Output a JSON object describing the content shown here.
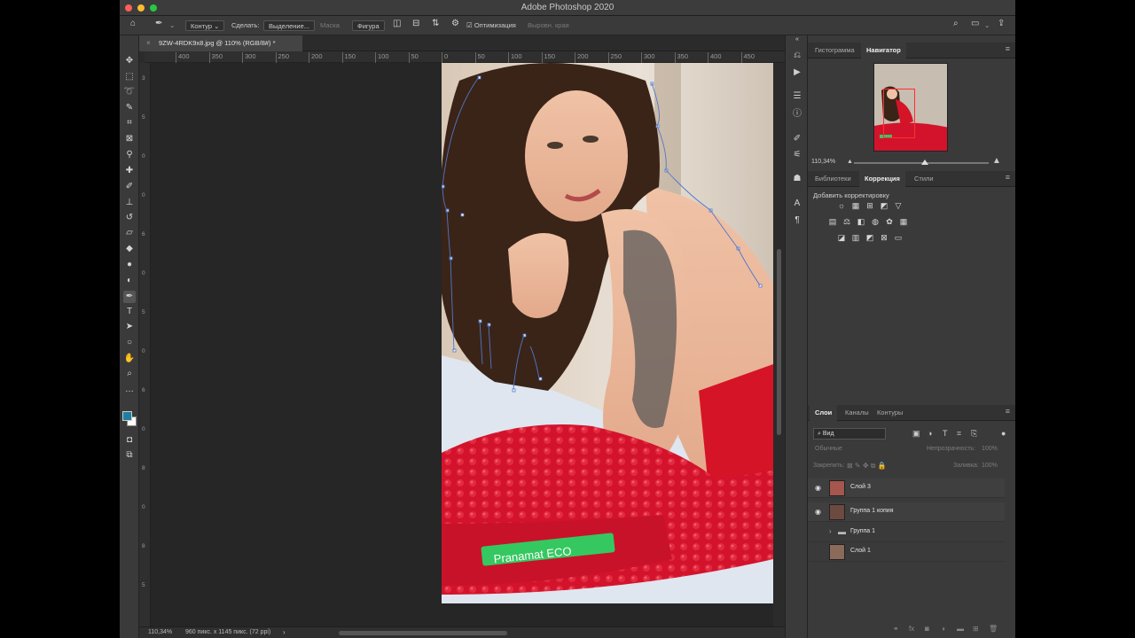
{
  "window": {
    "title": "Adobe Photoshop 2020",
    "colors": {
      "close": "#fe5f57",
      "minimize": "#febc2e",
      "zoom": "#28c840"
    }
  },
  "options_bar": {
    "mode": "Контур",
    "make_label": "Сделать:",
    "selection_button": "Выделение...",
    "mask_button": "Маска",
    "shape_button": "Фигура",
    "optimize_label": "Оптимизация",
    "align_edges": "Выровн. края"
  },
  "document": {
    "tab_title": "9ZW-4RDK9x8.jpg @ 110% (RGB/8#) *"
  },
  "ruler": {
    "h_ticks": [
      "400",
      "350",
      "300",
      "250",
      "200",
      "150",
      "100",
      "50",
      "0",
      "50",
      "100",
      "150",
      "200",
      "250",
      "300",
      "350",
      "400",
      "450"
    ],
    "v_ticks": [
      "3",
      "5",
      "0",
      "0",
      "6",
      "0",
      "5",
      "0",
      "6",
      "0",
      "8",
      "0",
      "8",
      "5"
    ]
  },
  "status": {
    "zoom": "110,34%",
    "doc_info": "960 пикс. x 1145 пикс. (72 ppi)",
    "arrow": "›"
  },
  "navigator": {
    "tabs": [
      "Гистограмма",
      "Навигатор"
    ],
    "active_tab": "Навигатор",
    "zoom": "110,34%"
  },
  "adjustments": {
    "tabs": [
      "Библиотеки",
      "Коррекция",
      "Стили"
    ],
    "active_tab": "Коррекция",
    "title": "Добавить корректировку"
  },
  "layers": {
    "tabs": [
      "Слои",
      "Каналы",
      "Контуры"
    ],
    "active_tab": "Слои",
    "filter_kind": "Вид",
    "blend_mode": "Обычные",
    "opacity_label": "Непрозрачность:",
    "opacity_value": "100%",
    "lock_label": "Закрепить:",
    "fill_label": "Заливка:",
    "fill_value": "100%",
    "items": [
      {
        "name": "Слой 3",
        "visible": true,
        "type": "layer",
        "selected": true
      },
      {
        "name": "Группа 1 копия",
        "visible": true,
        "type": "layer",
        "selected": false
      },
      {
        "name": "Группа 1",
        "visible": false,
        "type": "group",
        "selected": false
      },
      {
        "name": "Слой 1",
        "visible": false,
        "type": "layer",
        "selected": false
      }
    ]
  }
}
